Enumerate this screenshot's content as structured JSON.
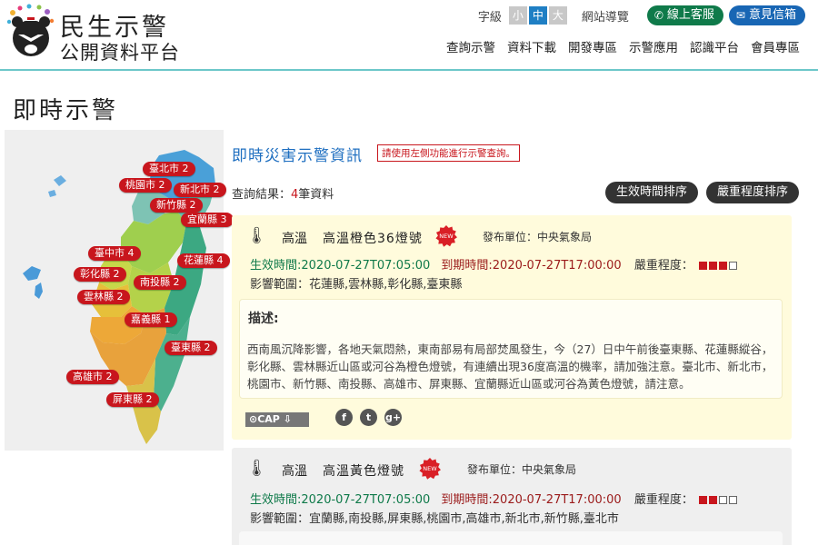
{
  "brand": {
    "title": "民生示警",
    "subtitle": "公開資料平台"
  },
  "util": {
    "font_label": "字級",
    "sizes": [
      "小",
      "中",
      "大"
    ],
    "sitemap": "網站導覽",
    "service": "線上客服",
    "feedback": "意見信箱"
  },
  "nav": [
    "查詢示警",
    "資料下載",
    "開發專區",
    "示警應用",
    "認識平台",
    "會員專區"
  ],
  "page_title": "即時示警",
  "map": {
    "tags": [
      {
        "label": "臺北市 2"
      },
      {
        "label": "桃園市 2"
      },
      {
        "label": "新北市 2"
      },
      {
        "label": "新竹縣 2"
      },
      {
        "label": "宜蘭縣 3"
      },
      {
        "label": "臺中市 4"
      },
      {
        "label": "花蓮縣 4"
      },
      {
        "label": "彰化縣 2"
      },
      {
        "label": "南投縣 2"
      },
      {
        "label": "雲林縣 2"
      },
      {
        "label": "嘉義縣 1"
      },
      {
        "label": "臺東縣 2"
      },
      {
        "label": "高雄市 2"
      },
      {
        "label": "屏東縣 2"
      }
    ]
  },
  "content": {
    "section_title": "即時災害示警資訊",
    "hint": "請使用左側功能進行示警查詢。",
    "result_prefix": "查詢結果：",
    "result_count": "4",
    "result_suffix": "筆資料",
    "sort_time": "生效時間排序",
    "sort_severity": "嚴重程度排序"
  },
  "alerts": [
    {
      "type": "高溫",
      "name": "高溫橙色36燈號",
      "badge": "NEW",
      "issuer": "發布單位：中央氣象局",
      "effective": "生效時間:2020-07-27T07:05:00",
      "expires": "到期時間:2020-07-27T17:00:00",
      "severity_label": "嚴重程度：",
      "severity_level": 3,
      "severity_max": 4,
      "areas": "影響範圍：花蓮縣,雲林縣,彰化縣,臺東縣",
      "desc_title": "描述:",
      "description": "西南風沉降影響，各地天氣悶熱，東南部易有局部焚風發生，今（27）日中午前後臺東縣、花蓮縣縱谷，彰化縣、雲林縣近山區或河谷為橙色燈號，有連續出現36度高溫的機率，請加強注意。臺北市、新北市，桃園市、新竹縣、南投縣、高雄市、屏東縣、宜蘭縣近山區或河谷為黃色燈號，請注意。",
      "cap": "CAP"
    },
    {
      "type": "高溫",
      "name": "高溫黃色燈號",
      "badge": "NEW",
      "issuer": "發布單位：中央氣象局",
      "effective": "生效時間:2020-07-27T07:05:00",
      "expires": "到期時間:2020-07-27T17:00:00",
      "severity_label": "嚴重程度：",
      "severity_level": 2,
      "severity_max": 4,
      "areas": "影響範圍：宜蘭縣,南投縣,屏東縣,桃園市,高雄市,新北市,新竹縣,臺北市"
    }
  ]
}
